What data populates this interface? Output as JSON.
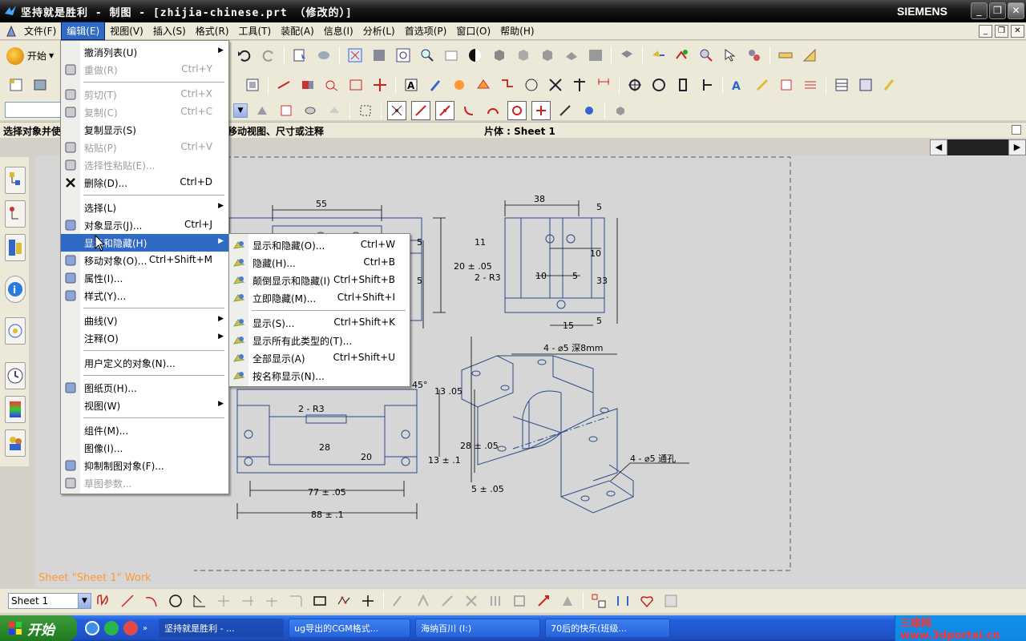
{
  "window": {
    "title": "坚持就是胜利 - 制图 - [zhijia-chinese.prt （修改的）]",
    "brand": "SIEMENS",
    "min_label": "_",
    "max_label": "❐",
    "close_label": "✕"
  },
  "menubar": {
    "items": [
      "文件(F)",
      "编辑(E)",
      "视图(V)",
      "插入(S)",
      "格式(R)",
      "工具(T)",
      "装配(A)",
      "信息(I)",
      "分析(L)",
      "首选项(P)",
      "窗口(O)",
      "帮助(H)"
    ],
    "active_index": 1
  },
  "toolbar": {
    "start_label": "开始"
  },
  "statusline": {
    "prompt": "选择对象并使",
    "hint": "移动视图、尺寸或注释",
    "part": "片体 : Sheet 1"
  },
  "edit_menu": {
    "items": [
      {
        "label": "撤消列表(U)",
        "shortcut": "",
        "submenu": true,
        "disabled": false,
        "icon": "",
        "sep_after": false
      },
      {
        "label": "重做(R)",
        "shortcut": "Ctrl+Y",
        "submenu": false,
        "disabled": true,
        "icon": "redo-icon",
        "sep_after": true
      },
      {
        "label": "剪切(T)",
        "shortcut": "Ctrl+X",
        "submenu": false,
        "disabled": true,
        "icon": "cut-icon",
        "sep_after": false
      },
      {
        "label": "复制(C)",
        "shortcut": "Ctrl+C",
        "submenu": false,
        "disabled": true,
        "icon": "copy-icon",
        "sep_after": false
      },
      {
        "label": "复制显示(S)",
        "shortcut": "",
        "submenu": false,
        "disabled": false,
        "icon": "",
        "sep_after": false
      },
      {
        "label": "粘贴(P)",
        "shortcut": "Ctrl+V",
        "submenu": false,
        "disabled": true,
        "icon": "paste-icon",
        "sep_after": false
      },
      {
        "label": "选择性粘贴(E)...",
        "shortcut": "",
        "submenu": false,
        "disabled": true,
        "icon": "paste-special-icon",
        "sep_after": false
      },
      {
        "label": "删除(D)...",
        "shortcut": "Ctrl+D",
        "submenu": false,
        "disabled": false,
        "icon": "delete-icon",
        "sep_after": true
      },
      {
        "label": "选择(L)",
        "shortcut": "",
        "submenu": true,
        "disabled": false,
        "icon": "",
        "sep_after": false
      },
      {
        "label": "对象显示(J)...",
        "shortcut": "Ctrl+J",
        "submenu": false,
        "disabled": false,
        "icon": "object-display-icon",
        "sep_after": false
      },
      {
        "label": "显示和隐藏(H)",
        "shortcut": "",
        "submenu": true,
        "disabled": false,
        "icon": "",
        "sep_after": false
      },
      {
        "label": "移动对象(O)...",
        "shortcut": "Ctrl+Shift+M",
        "submenu": false,
        "disabled": false,
        "icon": "move-object-icon",
        "sep_after": false
      },
      {
        "label": "属性(I)...",
        "shortcut": "",
        "submenu": false,
        "disabled": false,
        "icon": "properties-icon",
        "sep_after": false
      },
      {
        "label": "样式(Y)...",
        "shortcut": "",
        "submenu": false,
        "disabled": false,
        "icon": "style-icon",
        "sep_after": true
      },
      {
        "label": "曲线(V)",
        "shortcut": "",
        "submenu": true,
        "disabled": false,
        "icon": "",
        "sep_after": false
      },
      {
        "label": "注释(O)",
        "shortcut": "",
        "submenu": true,
        "disabled": false,
        "icon": "",
        "sep_after": true
      },
      {
        "label": "用户定义的对象(N)...",
        "shortcut": "",
        "submenu": false,
        "disabled": false,
        "icon": "",
        "sep_after": true
      },
      {
        "label": "图纸页(H)...",
        "shortcut": "",
        "submenu": false,
        "disabled": false,
        "icon": "drawing-sheet-icon",
        "sep_after": false
      },
      {
        "label": "视图(W)",
        "shortcut": "",
        "submenu": true,
        "disabled": false,
        "icon": "",
        "sep_after": true
      },
      {
        "label": "组件(M)...",
        "shortcut": "",
        "submenu": false,
        "disabled": false,
        "icon": "",
        "sep_after": false
      },
      {
        "label": "图像(I)...",
        "shortcut": "",
        "submenu": false,
        "disabled": false,
        "icon": "",
        "sep_after": false
      },
      {
        "label": "抑制制图对象(F)...",
        "shortcut": "",
        "submenu": false,
        "disabled": false,
        "icon": "suppress-icon",
        "sep_after": false
      },
      {
        "label": "草图参数...",
        "shortcut": "",
        "submenu": false,
        "disabled": true,
        "icon": "sketch-param-icon",
        "sep_after": false
      }
    ],
    "highlight_index": 10
  },
  "show_hide_menu": {
    "items": [
      {
        "label": "显示和隐藏(O)...",
        "shortcut": "Ctrl+W",
        "icon": "show-hide-icon",
        "sep_after": false
      },
      {
        "label": "隐藏(H)...",
        "shortcut": "Ctrl+B",
        "icon": "hide-icon",
        "sep_after": false
      },
      {
        "label": "颠倒显示和隐藏(I)",
        "shortcut": "Ctrl+Shift+B",
        "icon": "invert-display-icon",
        "sep_after": false
      },
      {
        "label": "立即隐藏(M)...",
        "shortcut": "Ctrl+Shift+I",
        "icon": "immediate-hide-icon",
        "sep_after": true
      },
      {
        "label": "显示(S)...",
        "shortcut": "Ctrl+Shift+K",
        "icon": "show-icon",
        "sep_after": false
      },
      {
        "label": "显示所有此类型的(T)...",
        "shortcut": "",
        "icon": "show-type-icon",
        "sep_after": false
      },
      {
        "label": "全部显示(A)",
        "shortcut": "Ctrl+Shift+U",
        "icon": "show-all-icon",
        "sep_after": false
      },
      {
        "label": "按名称显示(N)...",
        "shortcut": "",
        "icon": "show-by-name-icon",
        "sep_after": false
      }
    ]
  },
  "canvas": {
    "sheet_label": "Sheet \"Sheet 1\" Work"
  },
  "drawing": {
    "dims": [
      "55",
      "38",
      "5",
      "11",
      "2 - R3",
      "10",
      "10",
      "5",
      "33",
      "5",
      "15",
      "5",
      "20 ± .05",
      "5",
      "4 - ⌀5 深8mm",
      "45°",
      "13 .05",
      "2 - R3",
      "28 ± .05",
      "28",
      "20",
      "13 ± .1",
      "4 - ⌀5 通孔",
      "5 ± .05",
      "77 ± .05",
      "88 ± .1"
    ]
  },
  "bottom": {
    "sheet_select": "Sheet 1"
  },
  "taskbar": {
    "start": "开始",
    "tasks": [
      "坚持就是胜利 - ...",
      "ug导出的CGM格式...",
      "海纳百川 (I:)",
      "70后的快乐(班级..."
    ],
    "tray_text": "三维网www.3dportal.cn"
  },
  "colors": {
    "menu_highlight": "#316ac5",
    "drawing_line": "#2b4a8a",
    "sheet_label": "#ff9a33"
  }
}
